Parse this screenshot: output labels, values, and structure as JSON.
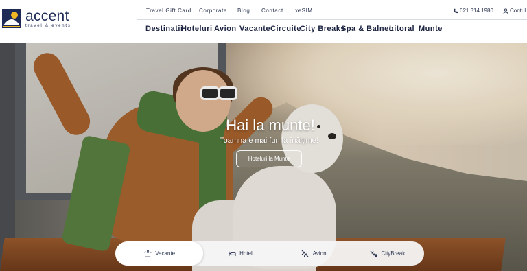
{
  "brand": {
    "name": "accent",
    "tagline": "travel & events",
    "primary_color": "#1e2b57",
    "accent_color": "#f2b824"
  },
  "topnav": {
    "links": [
      "Travel Gift Card",
      "Corporate",
      "Blog",
      "Contact",
      "xeSIM"
    ],
    "phone": "021 314 1980",
    "account": "Contul m"
  },
  "mainnav": {
    "items": [
      "Destinatii",
      "Hoteluri",
      "Avion",
      "Vacante",
      "Circuite",
      "City Breaks",
      "Spa & Balneo",
      "Litoral",
      "Munte"
    ]
  },
  "hero": {
    "title": "Hai la munte!",
    "subtitle": "Toamna e mai fun la înălțime!",
    "cta": "Hoteluri la Munte"
  },
  "search_tabs": {
    "items": [
      {
        "label": "Vacante",
        "icon": "palm-icon",
        "active": true
      },
      {
        "label": "Hotel",
        "icon": "bed-icon",
        "active": false
      },
      {
        "label": "Avion",
        "icon": "plane-icon",
        "active": false
      },
      {
        "label": "CityBreak",
        "icon": "plane-city-icon",
        "active": false
      }
    ]
  }
}
